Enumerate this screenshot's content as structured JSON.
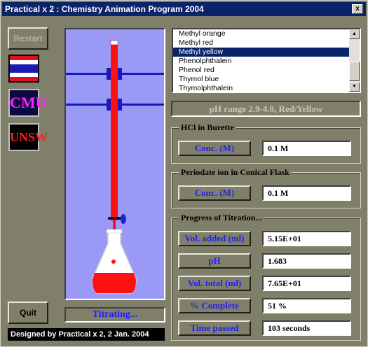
{
  "window": {
    "title": "Practical x 2 : Chemistry Animation Program 2004",
    "close": "x"
  },
  "left": {
    "restart_label": "Restart",
    "quit_label": "Quit",
    "logos": {
      "cmu": "CMU",
      "unsw": "UNSW"
    }
  },
  "apparatus": {
    "status": "Titrating..."
  },
  "footer": "Designed by Practical x 2, 2 Jan. 2004",
  "indicators": {
    "items": [
      "Methyl orange",
      "Methyl red",
      "Methyl yellow",
      "Phenolphthalein",
      "Phenol red",
      "Thymol blue",
      "Thymolphthalein"
    ],
    "selected": "Methyl yellow",
    "range_text": "pH range 2.9-4.0, Red/Yellow"
  },
  "burette": {
    "title": "HCl in Burette",
    "conc_label": "Conc. (M)",
    "conc_value": "0.1 M"
  },
  "flask": {
    "title": "Periodate ion in Conical Flask",
    "conc_label": "Conc. (M)",
    "conc_value": "0.1 M"
  },
  "progress": {
    "title": "Progress of Titration...",
    "vol_added_label": "Vol. added (ml)",
    "vol_added_value": "5.15E+01",
    "ph_label": "pH",
    "ph_value": "1.683",
    "vol_total_label": "Vol. total (ml)",
    "vol_total_value": "7.65E+01",
    "complete_label": "% Complete",
    "complete_value": "51 %",
    "time_label": "Time passed",
    "time_value": "103 seconds"
  },
  "colors": {
    "solution": "#ff1010",
    "background_apparatus": "#9a9af6",
    "label_text": "#1e1eff",
    "titlebar": "#0a246a"
  }
}
